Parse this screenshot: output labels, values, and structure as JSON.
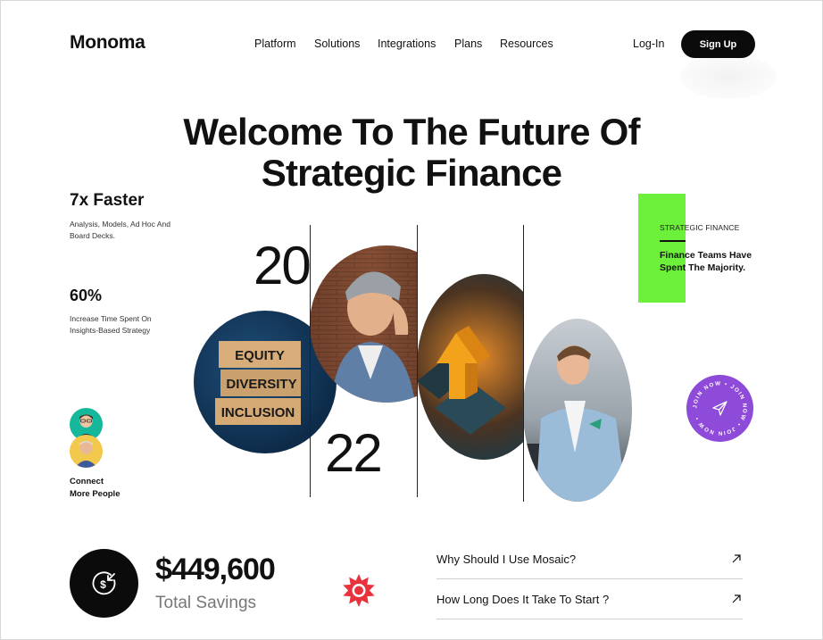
{
  "header": {
    "logo": "Monoma",
    "nav": [
      "Platform",
      "Solutions",
      "Integrations",
      "Plans",
      "Resources"
    ],
    "login_label": "Log-In",
    "signup_label": "Sign Up"
  },
  "hero": {
    "title_line1": "Welcome To The Future Of",
    "title_line2": "Strategic Finance"
  },
  "stats": {
    "faster_title": "7x Faster",
    "faster_desc": "Analysis, Models, Ad Hoc And Board Decks.",
    "percent_title": "60%",
    "percent_desc": "Increase Time Spent On Insights-Based Strategy",
    "connect_line1": "Connect",
    "connect_line2": "More People"
  },
  "gallery": {
    "year_top": "20",
    "year_bottom": "22",
    "equity_words": [
      "EQUITY",
      "DIVERSITY",
      "INCLUSION"
    ]
  },
  "strategic": {
    "label": "STRATEGIC FINANCE",
    "text": "Finance Teams Have Spent The Majority."
  },
  "join_badge": {
    "text": "JOIN NOW • JOIN NOW • JOIN NOW •",
    "color": "#8e4bd9"
  },
  "savings": {
    "value": "$449,600",
    "label": "Total Savings"
  },
  "faq": [
    {
      "question": "Why Should I Use Mosaic?"
    },
    {
      "question": "How Long Does It Take To Start ?"
    }
  ],
  "colors": {
    "accent_green": "#6cf03a",
    "accent_purple": "#8e4bd9",
    "accent_red": "#e8323c",
    "dark": "#0b0b0b"
  }
}
